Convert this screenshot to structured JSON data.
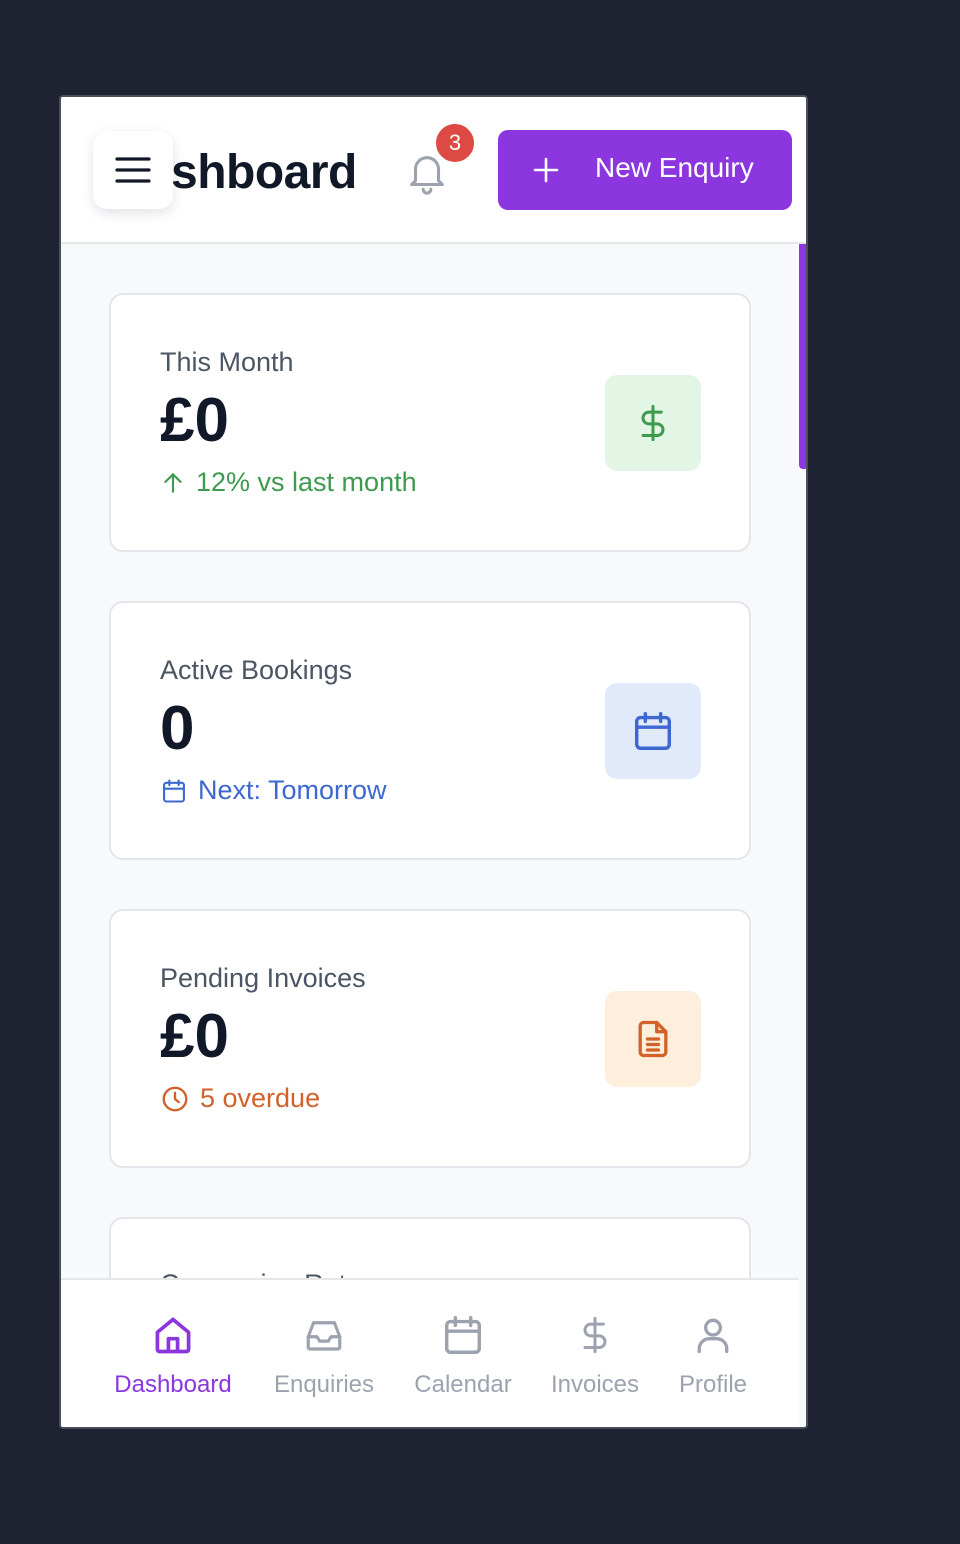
{
  "header": {
    "title": "shboard",
    "notification_count": "3",
    "new_button_label": "New Enquiry"
  },
  "stats": [
    {
      "label": "This Month",
      "value": "£0",
      "trend": "12% vs last month",
      "trend_icon": "arrow-up-icon",
      "icon": "dollar-icon",
      "accent": "#3d9a4e",
      "icon_bg": "#e3f6e6"
    },
    {
      "label": "Active Bookings",
      "value": "0",
      "trend": "Next: Tomorrow",
      "trend_icon": "calendar-icon",
      "icon": "calendar-icon",
      "accent": "#3d68d1",
      "icon_bg": "#e1eafa"
    },
    {
      "label": "Pending Invoices",
      "value": "£0",
      "trend": "5 overdue",
      "trend_icon": "clock-icon",
      "icon": "document-icon",
      "accent": "#d2622a",
      "icon_bg": "#fdefdc"
    },
    {
      "label": "Conversion Rate"
    }
  ],
  "nav": [
    {
      "label": "Dashboard",
      "icon": "home-icon",
      "active": true
    },
    {
      "label": "Enquiries",
      "icon": "inbox-icon"
    },
    {
      "label": "Calendar",
      "icon": "calendar-icon"
    },
    {
      "label": "Invoices",
      "icon": "dollar-icon"
    },
    {
      "label": "Profile",
      "icon": "user-icon"
    }
  ],
  "colors": {
    "brand": "#8b36de",
    "badge": "#dc4a43",
    "background": "#1e2231"
  }
}
